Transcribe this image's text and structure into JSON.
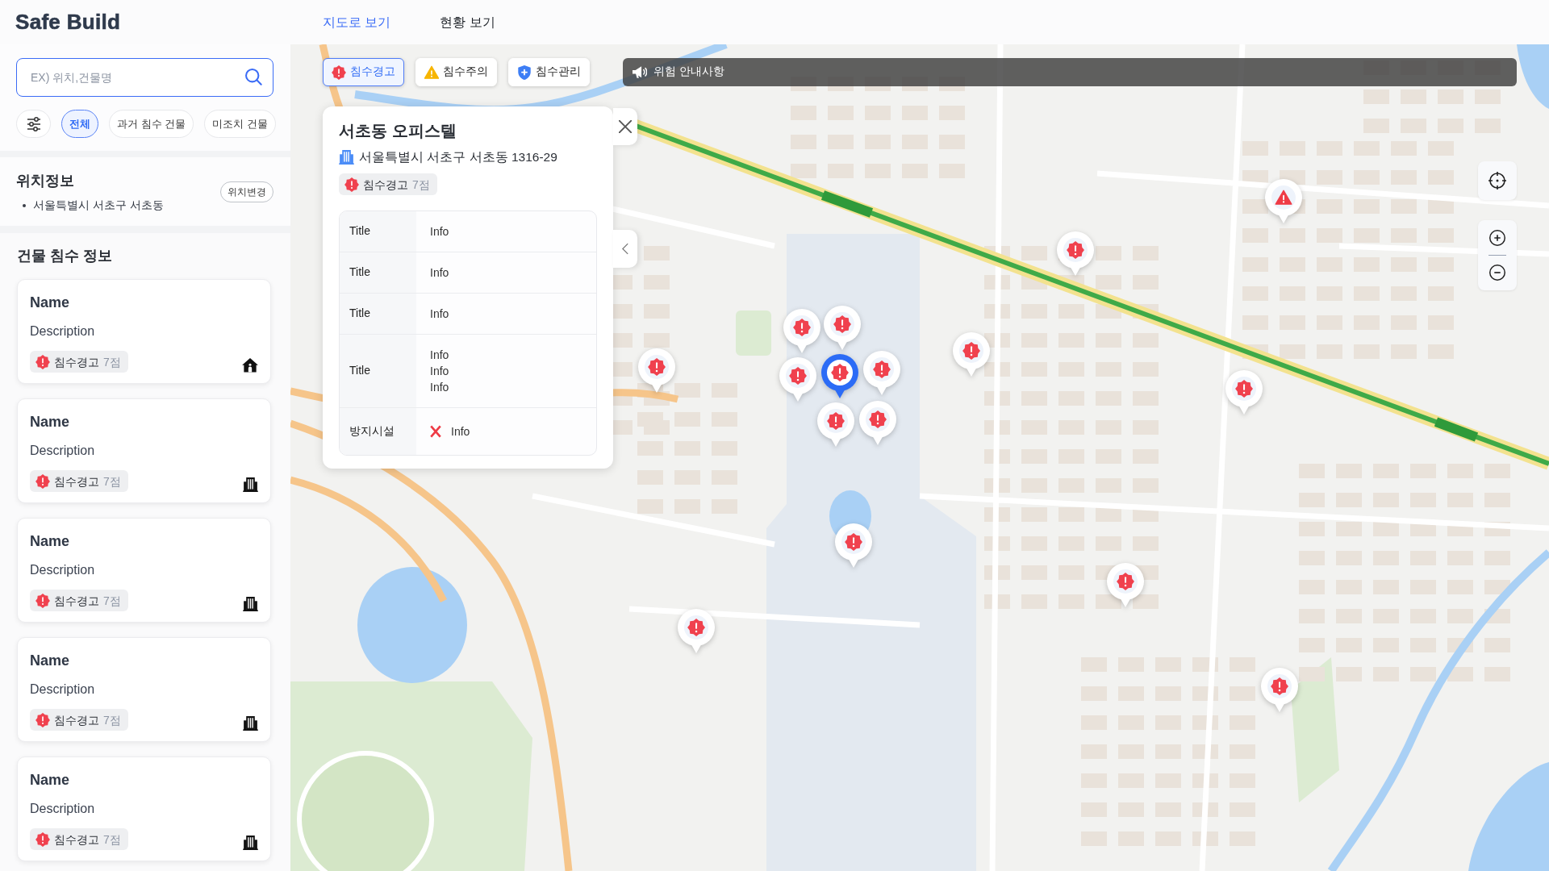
{
  "header": {
    "logo": "Safe Build",
    "tabs": [
      {
        "label": "지도로 보기",
        "selected": true
      },
      {
        "label": "현황 보기",
        "selected": false
      }
    ]
  },
  "sidebar": {
    "search": {
      "placeholder": "EX) 위치,건물명"
    },
    "filters": [
      {
        "label": "전체",
        "selected": true
      },
      {
        "label": "과거 침수 건물",
        "selected": false
      },
      {
        "label": "미조치 건물",
        "selected": false
      }
    ],
    "location": {
      "title": "위치정보",
      "button": "위치변경",
      "address": "서울특별시 서초구 서초동"
    },
    "buildings": {
      "title": "건물 침수 정보",
      "items": [
        {
          "kind": "house",
          "name": "Name",
          "description": "Description",
          "status": {
            "kind": "warning",
            "label": "침수경고",
            "score": "7점"
          }
        },
        {
          "kind": "building",
          "name": "Name",
          "description": "Description",
          "status": {
            "kind": "warning",
            "label": "침수경고",
            "score": "7점"
          }
        },
        {
          "kind": "building",
          "name": "Name",
          "description": "Description",
          "status": {
            "kind": "warning",
            "label": "침수경고",
            "score": "7점"
          }
        },
        {
          "kind": "building",
          "name": "Name",
          "description": "Description",
          "status": {
            "kind": "warning",
            "label": "침수경고",
            "score": "7점"
          }
        },
        {
          "kind": "building",
          "name": "Name",
          "description": "Description",
          "status": {
            "kind": "warning",
            "label": "침수경고",
            "score": "7점"
          }
        }
      ]
    }
  },
  "map": {
    "filters": [
      {
        "kind": "warning",
        "label": "침수경고",
        "selected": true
      },
      {
        "kind": "caution",
        "label": "침수주의",
        "selected": false
      },
      {
        "kind": "managed",
        "label": "침수관리",
        "selected": false
      }
    ],
    "notice": "위험 안내사항",
    "popup": {
      "title": "서초동 오피스텔",
      "address": "서울특별시 서초구 서초동 1316-29",
      "status": {
        "kind": "warning",
        "label": "침수경고",
        "score": "7점"
      },
      "rows": [
        {
          "kind": "text",
          "title": "Title",
          "values": [
            "Info"
          ]
        },
        {
          "kind": "text",
          "title": "Title",
          "values": [
            "Info"
          ]
        },
        {
          "kind": "text",
          "title": "Title",
          "values": [
            "Info"
          ]
        },
        {
          "kind": "text",
          "title": "Title",
          "values": [
            "Info",
            "Info",
            "Info"
          ]
        },
        {
          "kind": "facility",
          "title": "방지시설",
          "installed": false,
          "values": [
            "Info"
          ]
        }
      ]
    },
    "markers": [
      {
        "kind": "warning",
        "selected": false
      },
      {
        "kind": "warning",
        "selected": false
      },
      {
        "kind": "warning",
        "selected": false
      },
      {
        "kind": "warning",
        "selected": false
      },
      {
        "kind": "warning",
        "selected": false
      },
      {
        "kind": "warning",
        "selected": false
      },
      {
        "kind": "warning",
        "selected": false
      },
      {
        "kind": "warning",
        "selected": true
      },
      {
        "kind": "warning",
        "selected": false
      },
      {
        "kind": "warning",
        "selected": false
      },
      {
        "kind": "triangle",
        "selected": false
      },
      {
        "kind": "warning",
        "selected": false
      },
      {
        "kind": "warning",
        "selected": false
      },
      {
        "kind": "warning",
        "selected": false
      },
      {
        "kind": "warning",
        "selected": false
      },
      {
        "kind": "warning",
        "selected": false
      }
    ]
  }
}
